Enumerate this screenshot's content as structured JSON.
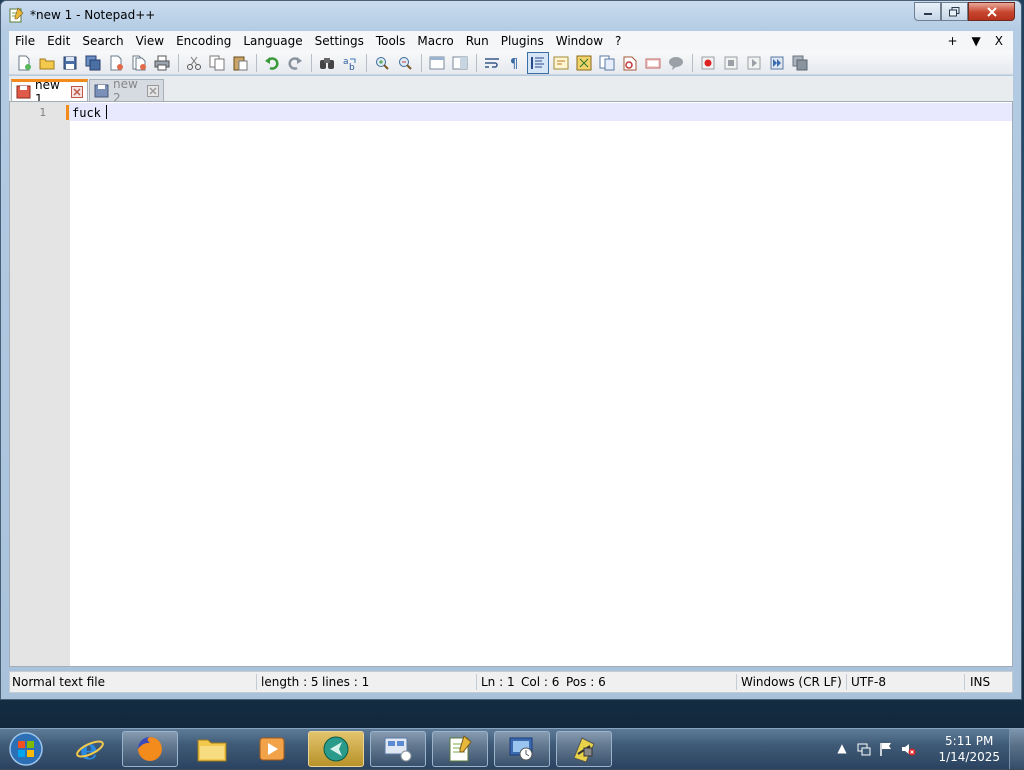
{
  "window": {
    "title": "*new 1 - Notepad++"
  },
  "menubar": {
    "items": [
      "File",
      "Edit",
      "Search",
      "View",
      "Encoding",
      "Language",
      "Settings",
      "Tools",
      "Macro",
      "Run",
      "Plugins",
      "Window",
      "?"
    ],
    "right_items": [
      "+",
      "▼",
      "X"
    ]
  },
  "tabs": [
    {
      "label": "new 1",
      "active": true,
      "modified": true
    },
    {
      "label": "new 2",
      "active": false,
      "modified": false
    }
  ],
  "editor": {
    "line_numbers": [
      "1"
    ],
    "lines": [
      "fuck"
    ]
  },
  "statusbar": {
    "file_type": "Normal text file",
    "length": "length : 5",
    "lines": "lines : 1",
    "ln": "Ln : 1",
    "col": "Col : 6",
    "pos": "Pos : 6",
    "eol": "Windows (CR LF)",
    "encoding": "UTF-8",
    "mode": "INS"
  },
  "taskbar": {
    "apps": [
      "internet-explorer",
      "firefox",
      "file-explorer",
      "media-player",
      "app-teal",
      "network-app",
      "notepadpp",
      "system-tool",
      "game-app"
    ],
    "time": "5:11 PM",
    "date": "1/14/2025"
  },
  "colors": {
    "tab_active_accent": "#f28a1c",
    "current_line_bg": "#e8e8ff",
    "close_button": "#c7442e"
  }
}
